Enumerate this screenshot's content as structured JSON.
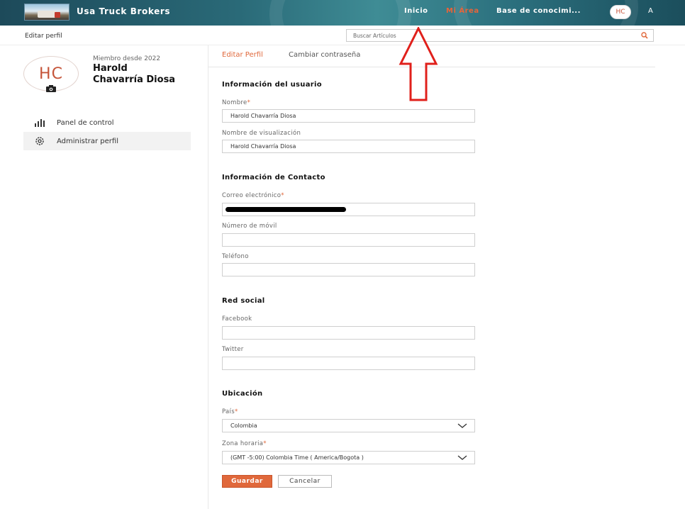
{
  "header": {
    "brand": "Usa Truck Brokers",
    "nav": {
      "inicio": "Inicio",
      "mi_area": "Mi Área",
      "base": "Base de conocimi..."
    },
    "avatar_initials": "HC",
    "lang": "A"
  },
  "subheader": {
    "breadcrumb": "Editar perfil",
    "search_placeholder": "Buscar Artículos"
  },
  "profile": {
    "initials": "HC",
    "member_since": "Miembro desde 2022",
    "name": "Harold Chavarría Diosa"
  },
  "sidebar": {
    "items": [
      {
        "label": "Panel de control",
        "icon": "bar-chart-icon"
      },
      {
        "label": "Administrar perfil",
        "icon": "gear-icon"
      }
    ]
  },
  "tabs": {
    "edit": "Editar Perfil",
    "password": "Cambiar contraseña"
  },
  "form": {
    "user_info_title": "Información del usuario",
    "name_label": "Nombre",
    "name_value": "Harold Chavarría Diosa",
    "display_label": "Nombre de visualización",
    "display_value": "Harold Chavarría Diosa",
    "contact_title": "Información de Contacto",
    "email_label": "Correo electrónico",
    "email_value": "",
    "mobile_label": "Número de móvil",
    "mobile_value": "",
    "phone_label": "Teléfono",
    "phone_value": "",
    "social_title": "Red social",
    "facebook_label": "Facebook",
    "facebook_value": "",
    "twitter_label": "Twitter",
    "twitter_value": "",
    "location_title": "Ubicación",
    "country_label": "País",
    "country_value": "Colombia",
    "tz_label": "Zona horaria",
    "tz_value": "(GMT -5:00) Colombia Time ( America/Bogota )",
    "required_mark": "*",
    "save": "Guardar",
    "cancel": "Cancelar"
  },
  "colors": {
    "accent": "#e0683b",
    "arrow": "#e0201b"
  }
}
